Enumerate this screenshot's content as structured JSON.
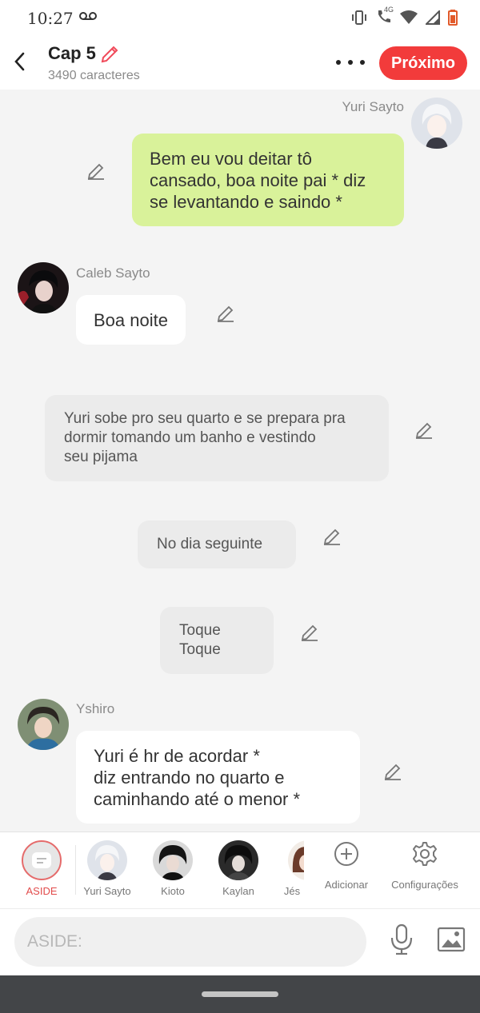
{
  "status": {
    "time": "10:27",
    "network": "4G"
  },
  "header": {
    "title": "Cap 5",
    "subtitle": "3490 caracteres",
    "next_label": "Próximo"
  },
  "messages": [
    {
      "speaker": "Yuri Sayto",
      "text": "Bem eu vou deitar tô\ncansado, boa noite pai * diz\nse levantando e saindo *"
    },
    {
      "speaker": "Caleb Sayto",
      "text": "Boa noite"
    },
    {
      "text": "Yuri sobe pro seu quarto e se prepara pra\ndormir tomando um banho e vestindo\nseu pijama"
    },
    {
      "text": "No dia seguinte"
    },
    {
      "text": "Toque\n      Toque"
    },
    {
      "speaker": "Yshiro",
      "text": "Yuri é hr de acordar *\ndiz entrando no quarto e\ncaminhando até o menor *"
    }
  ],
  "characters": [
    {
      "label": "ASIDE"
    },
    {
      "label": "Yuri Sayto"
    },
    {
      "label": "Kioto"
    },
    {
      "label": "Kaylan"
    },
    {
      "label": "Jés"
    }
  ],
  "actions": {
    "add_label": "Adicionar",
    "settings_label": "Configurações"
  },
  "input": {
    "placeholder": "ASIDE:"
  },
  "colors": {
    "accent": "#f23b3b",
    "own_bubble": "#d9f29a",
    "narration_bubble": "#ebebeb"
  }
}
